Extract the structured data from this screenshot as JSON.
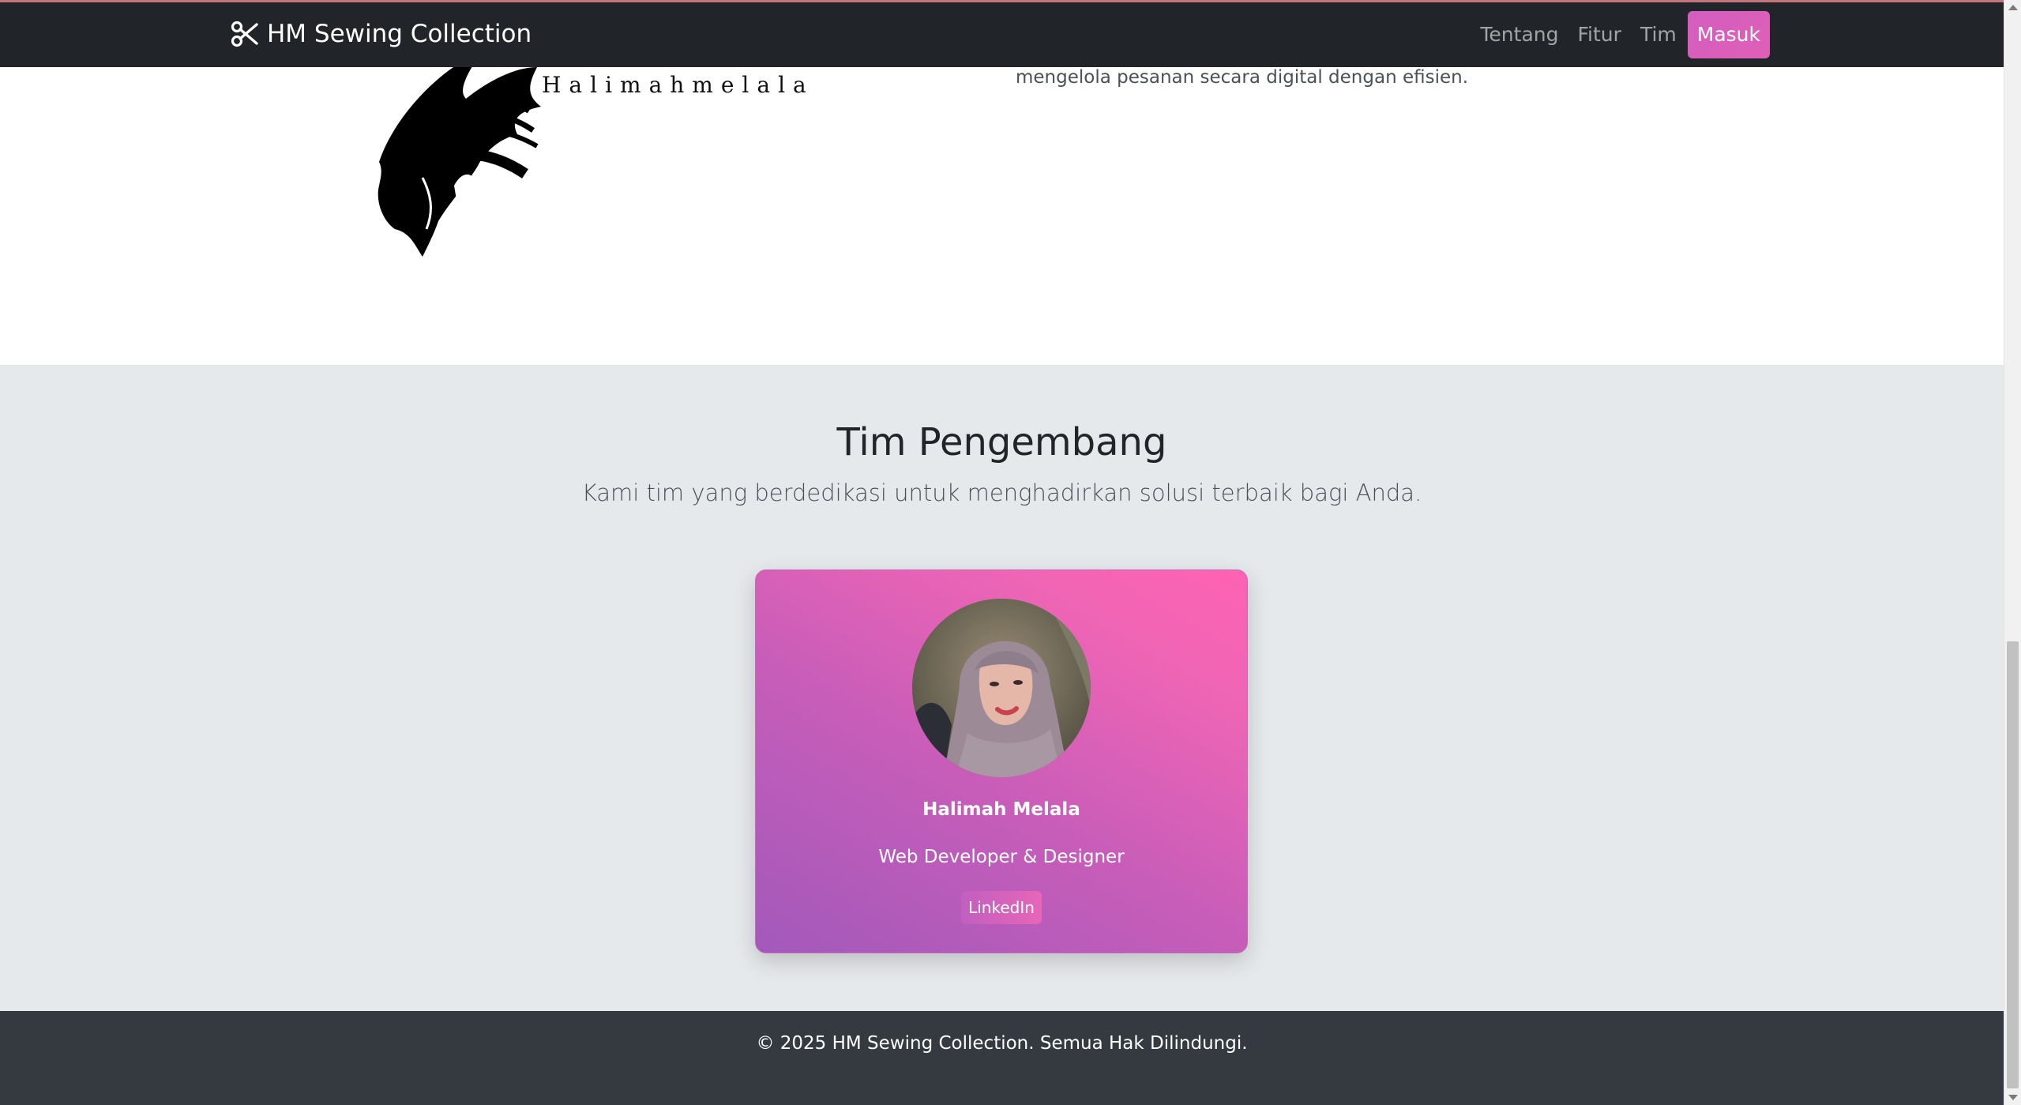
{
  "navbar": {
    "brand_icon": "scissors-icon",
    "brand_title": "HM Sewing Collection",
    "links": [
      {
        "label": "Tentang"
      },
      {
        "label": "Fitur"
      },
      {
        "label": "Tim"
      }
    ],
    "login_label": "Masuk"
  },
  "about": {
    "signature_name": "Halimahmelala",
    "text": "mengelola pesanan secara digital dengan efisien."
  },
  "team": {
    "title": "Tim Pengembang",
    "subtitle": "Kami tim yang berdedikasi untuk menghadirkan solusi terbaik bagi Anda.",
    "members": [
      {
        "name": "Halimah Melala",
        "role": "Web Developer & Designer",
        "link_label": "LinkedIn"
      }
    ]
  },
  "footer": {
    "text": "© 2025 HM Sewing Collection. Semua Hak Dilindungi."
  },
  "colors": {
    "navbar_bg": "#212529",
    "accent": "#e05fb6",
    "team_bg": "#e6e9ec",
    "footer_bg": "#343a40"
  }
}
